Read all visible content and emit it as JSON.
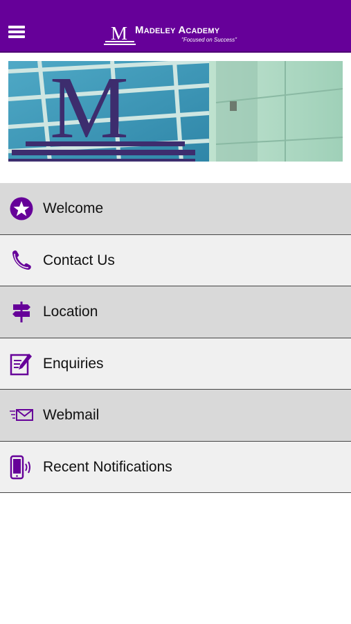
{
  "header": {
    "brand_name": "Madeley Academy",
    "tagline": "\"Focused on Success\"",
    "menu_icon": "hamburger-menu-icon",
    "background_color": "#660099"
  },
  "menu": {
    "items": [
      {
        "label": "Welcome",
        "icon": "star-icon"
      },
      {
        "label": "Contact Us",
        "icon": "phone-icon"
      },
      {
        "label": "Location",
        "icon": "signpost-icon"
      },
      {
        "label": "Enquiries",
        "icon": "edit-form-icon"
      },
      {
        "label": "Webmail",
        "icon": "mail-icon"
      },
      {
        "label": "Recent Notifications",
        "icon": "mobile-notification-icon"
      }
    ],
    "accent_color": "#660099"
  }
}
